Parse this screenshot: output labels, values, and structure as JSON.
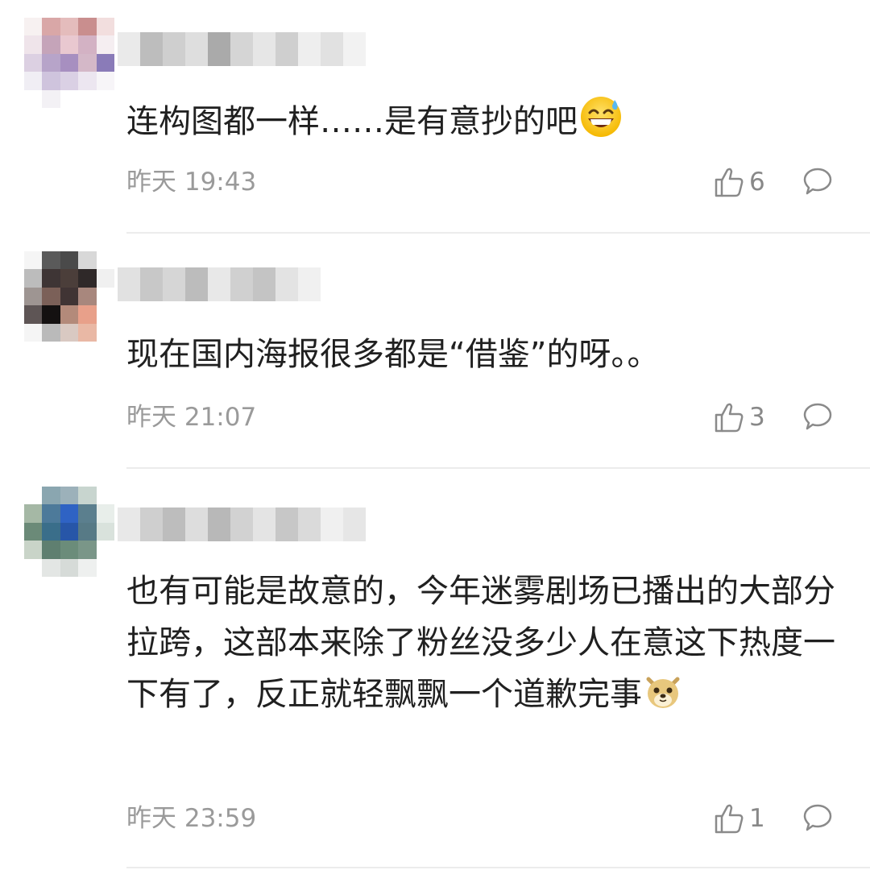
{
  "comments": [
    {
      "text": "连构图都一样……是有意抄的吧",
      "emoji": "grinning-sweat-emoji",
      "time": "昨天 19:43",
      "likes": "6",
      "avatar_colors": [
        "#f7f1f1",
        "#d9a7a7",
        "#e4bcbc",
        "#c98e8e",
        "#f2dede",
        "#efe4ea",
        "#c5a4b9",
        "#e9c8d0",
        "#d3b2c4",
        "#f5eef1",
        "#dcd0e2",
        "#b7a4c9",
        "#a78fc0",
        "#d4b8c8",
        "#8a7bb8",
        "#f0eef4",
        "#cfc4dd",
        "#dad0e4",
        "#ece6f0",
        "#f7f5f8",
        "#ffffff",
        "#f3f1f5",
        "#ffffff",
        "#ffffff",
        "#ffffff"
      ],
      "username_colors": [
        "#eaeaea",
        "#bdbdbd",
        "#cfcfcf",
        "#dedede",
        "#aaaaaa",
        "#d5d5d5",
        "#e6e6e6",
        "#cfcfcf",
        "#eeeeee",
        "#e1e1e1",
        "#f2f2f2"
      ]
    },
    {
      "text": "现在国内海报很多都是“借鉴”的呀。。",
      "emoji": "",
      "time": "昨天 21:07",
      "likes": "3",
      "avatar_colors": [
        "#f5f5f5",
        "#5a5a5a",
        "#4a4a4a",
        "#d8d8d8",
        "#ffffff",
        "#bcbcbc",
        "#3e3535",
        "#4b3e3a",
        "#2f2929",
        "#f0f0f0",
        "#9e9592",
        "#7b6058",
        "#403434",
        "#a8877d",
        "#ffffff",
        "#5e5555",
        "#141111",
        "#b38a7a",
        "#e8a08a",
        "#ffffff",
        "#f5f5f5",
        "#bababa",
        "#d9c9c2",
        "#e9b8a5",
        "#ffffff"
      ],
      "username_colors": [
        "#e1e1e1",
        "#c8c8c8",
        "#d6d6d6",
        "#bcbcbc",
        "#e8e8e8",
        "#d0d0d0",
        "#c4c4c4",
        "#e3e3e3",
        "#f0f0f0"
      ]
    },
    {
      "text": "也有可能是故意的，今年迷雾剧场已播出的大部分拉跨，这部本来除了粉丝没多少人在意这下热度一下有了，反正就轻飘飘一个道歉完事",
      "emoji": "doge-emoji",
      "time": "昨天 23:59",
      "likes": "1",
      "avatar_colors": [
        "#ffffff",
        "#8aa6b0",
        "#9cb1ba",
        "#c8d5cf",
        "#ffffff",
        "#a5b8a5",
        "#4d7a9a",
        "#2f63c4",
        "#5b7f8e",
        "#e8eeea",
        "#6b8a78",
        "#3a6e8a",
        "#2756a8",
        "#577a86",
        "#d9e2dc",
        "#c9d4c8",
        "#5f7f70",
        "#6b8c7a",
        "#7a9688",
        "#ffffff",
        "#ffffff",
        "#e3e6e4",
        "#d6dbd8",
        "#eef0ef",
        "#ffffff"
      ],
      "username_colors": [
        "#e8e8e8",
        "#cfcfcf",
        "#bdbdbd",
        "#dddddd",
        "#b8b8b8",
        "#d2d2d2",
        "#e4e4e4",
        "#c7c7c7",
        "#dadada",
        "#f0f0f0",
        "#e6e6e6"
      ]
    }
  ]
}
